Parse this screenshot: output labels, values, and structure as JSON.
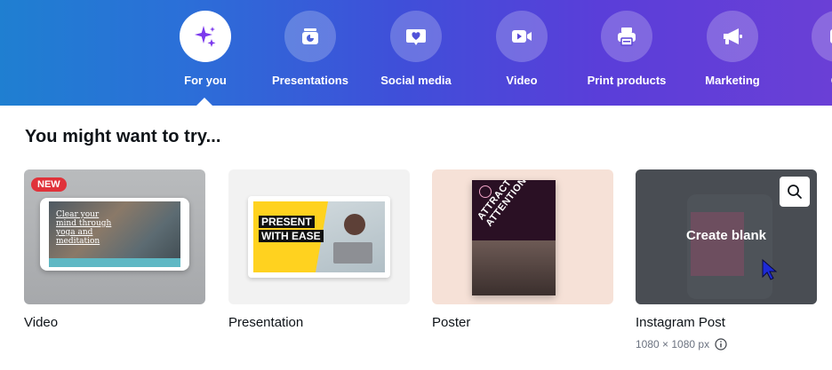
{
  "categories": [
    {
      "label": "For you",
      "icon": "sparkle-icon",
      "active": true
    },
    {
      "label": "Presentations",
      "icon": "presentation-chart-icon",
      "active": false
    },
    {
      "label": "Social media",
      "icon": "heart-chat-icon",
      "active": false
    },
    {
      "label": "Video",
      "icon": "video-camera-icon",
      "active": false
    },
    {
      "label": "Print products",
      "icon": "printer-icon",
      "active": false
    },
    {
      "label": "Marketing",
      "icon": "megaphone-icon",
      "active": false
    },
    {
      "label": "Ot",
      "icon": "more-icon",
      "active": false
    }
  ],
  "section": {
    "title": "You might want to try..."
  },
  "cards": [
    {
      "name": "Video",
      "badge": "NEW",
      "thumb_text": "Clear your mind through yoga and meditation"
    },
    {
      "name": "Presentation",
      "thumb_line1": "PRESENT",
      "thumb_line2": "WITH EASE"
    },
    {
      "name": "Poster",
      "thumb_text": "ATTRACT MORE ATTENTION"
    },
    {
      "name": "Instagram Post",
      "overlay_label": "Create blank",
      "meta": "1080 × 1080 px"
    }
  ],
  "colors": {
    "band_start": "#1f7fd1",
    "band_end": "#6a3fd6",
    "active_icon": "#7c3aed",
    "badge_new": "#e0323a"
  }
}
